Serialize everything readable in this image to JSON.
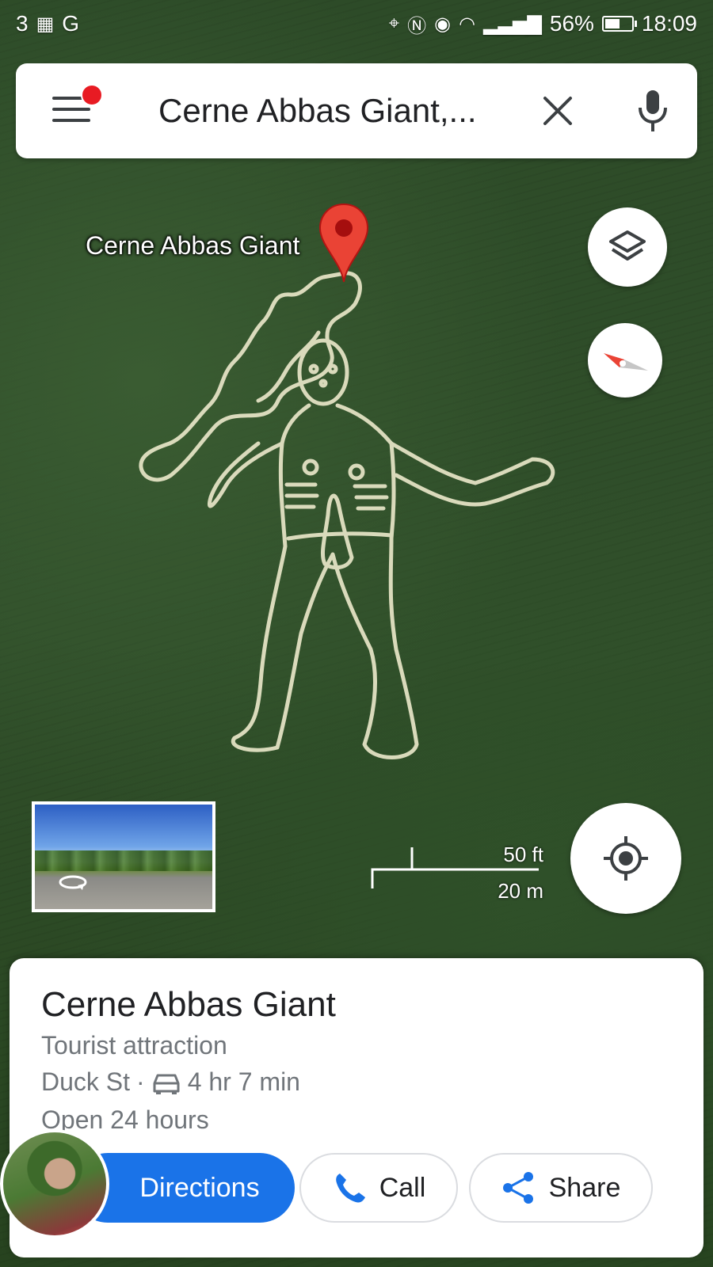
{
  "status_bar": {
    "left_text": "3",
    "network": "G",
    "battery": "56%",
    "battery_level": 0.56,
    "time": "18:09"
  },
  "search": {
    "query": "Cerne Abbas Giant,..."
  },
  "map": {
    "pin_label": "Cerne Abbas Giant",
    "scale_imperial": "50 ft",
    "scale_metric": "20 m"
  },
  "icons": {
    "menu": "hamburger-menu-icon",
    "clear": "close-icon",
    "mic": "microphone-icon",
    "layers": "layers-icon",
    "compass": "compass-icon",
    "location": "my-location-icon",
    "car": "car-icon",
    "phone": "phone-icon",
    "share": "share-icon",
    "pin": "map-pin-icon",
    "rotate": "360-rotate-icon"
  },
  "colors": {
    "primary_blue": "#1a73e8",
    "pin_red": "#ea4335",
    "notification_red": "#e81b23"
  },
  "place": {
    "title": "Cerne Abbas Giant",
    "type": "Tourist attraction",
    "street": "Duck St",
    "separator": "·",
    "drive_time": "4 hr 7 min",
    "hours": "Open 24 hours"
  },
  "actions": {
    "directions": "Directions",
    "call": "Call",
    "share": "Share"
  }
}
